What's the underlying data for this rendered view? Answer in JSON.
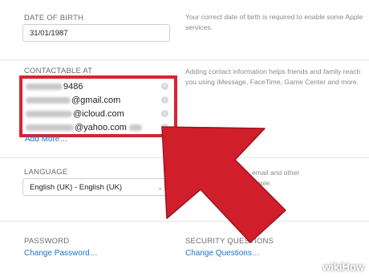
{
  "dob": {
    "label": "DATE OF BIRTH",
    "value": "31/01/1987",
    "desc_line1": "Your correct date of birth is required to enable some Apple",
    "desc_line2": "services."
  },
  "contactable": {
    "label": "CONTACTABLE AT",
    "desc_line1": "Adding contact information helps friends and family reach",
    "desc_line2": "you using iMessage, FaceTime, Game Center and more.",
    "items": [
      {
        "suffix": "9486",
        "icon": "x-circle-icon"
      },
      {
        "suffix": "@gmail.com",
        "icon": "info-circle-icon"
      },
      {
        "suffix": "@icloud.com",
        "icon": "info-circle-icon"
      },
      {
        "suffix": "@yahoo.com",
        "icon": "info-circle-icon"
      }
    ],
    "add_more": "Add More…"
  },
  "language": {
    "label": "LANGUAGE",
    "selected": "English (UK) - English (UK)",
    "desc_line1": "email and other",
    "desc_line2": "Apple."
  },
  "password": {
    "label": "PASSWORD",
    "link": "Change Password…"
  },
  "security": {
    "label": "SECURITY QUESTIONS",
    "link": "Change Questions…"
  },
  "watermark": "wikiHow",
  "colors": {
    "highlight": "#d42632",
    "link": "#1a73c8"
  }
}
